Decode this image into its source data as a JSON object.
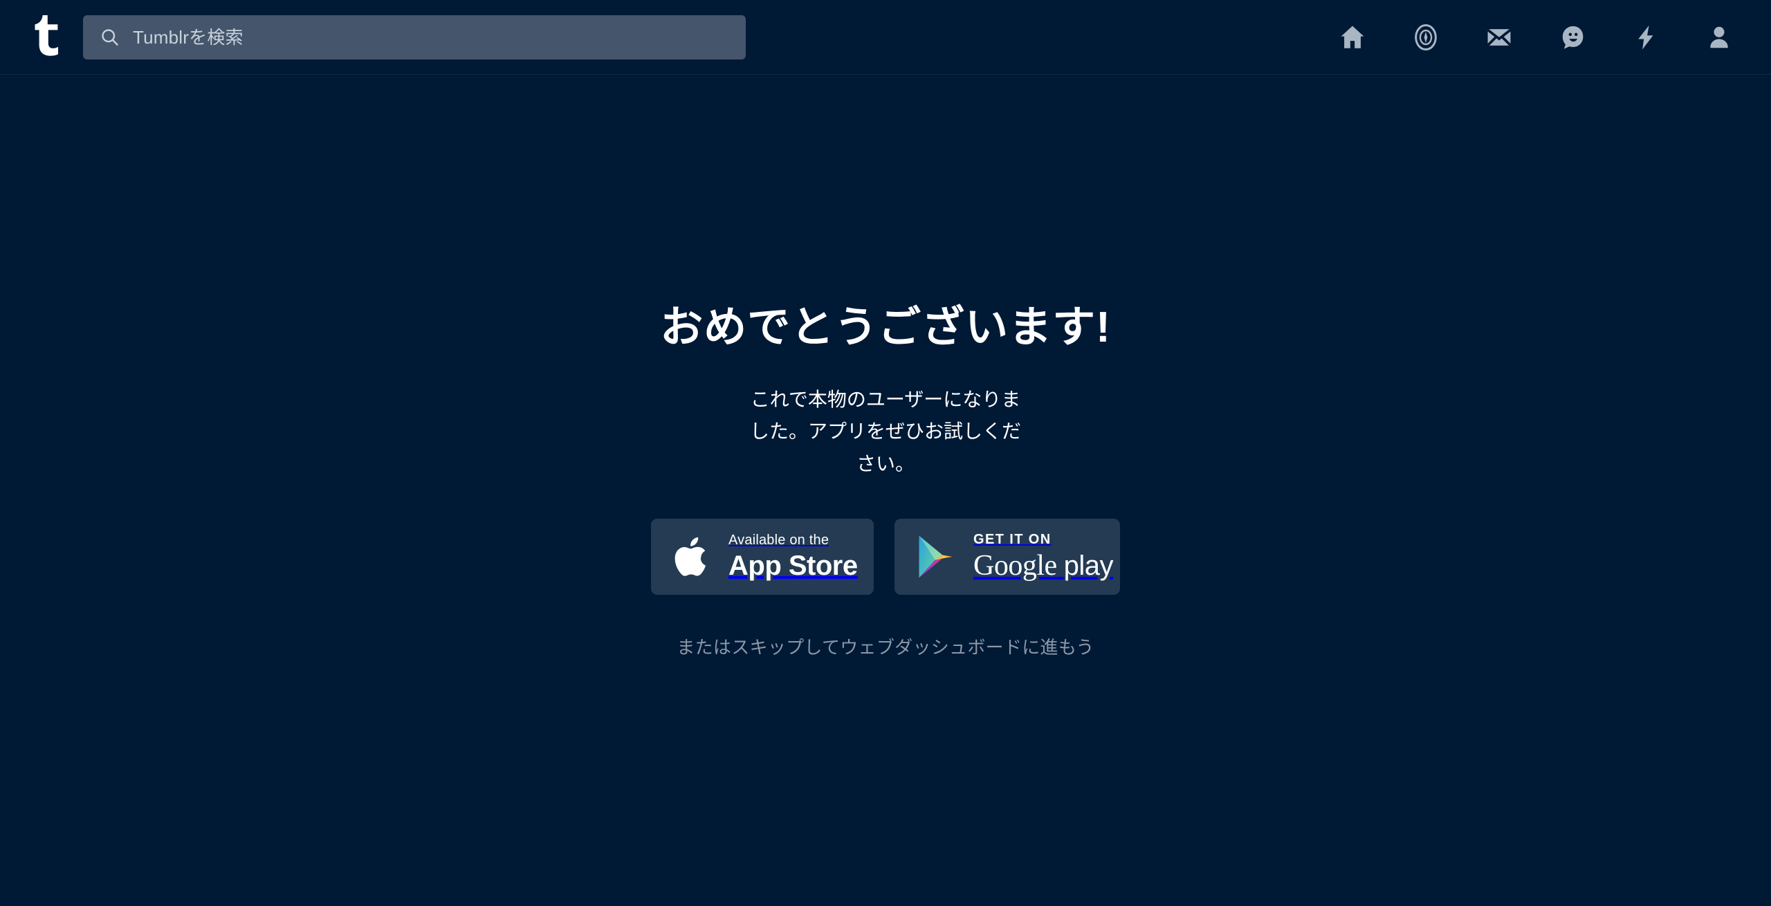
{
  "theme": {
    "background": "#001935",
    "header_background": "#001935",
    "header_border": "#0d2a47",
    "search_background": "#45556b",
    "badge_background": "#243b53",
    "text_primary": "#ffffff",
    "text_muted": "#8a98a8",
    "icon_color": "#a8b6c4"
  },
  "header": {
    "logo_label": "t",
    "search": {
      "placeholder": "Tumblrを検索",
      "value": ""
    },
    "nav": [
      {
        "name": "home-icon",
        "label": "ホーム"
      },
      {
        "name": "compass-icon",
        "label": "見つける"
      },
      {
        "name": "mail-icon",
        "label": "メッセージ"
      },
      {
        "name": "chat-smiley-icon",
        "label": "チャット"
      },
      {
        "name": "lightning-icon",
        "label": "アクティビティ"
      },
      {
        "name": "account-icon",
        "label": "アカウント"
      }
    ]
  },
  "main": {
    "headline": "おめでとうございます!",
    "subtext": "これで本物のユーザーになりました。アプリをぜひお試しください。",
    "badges": [
      {
        "name": "app-store-badge",
        "small_text": "Available on the",
        "large_text": "App Store",
        "icon": "apple-icon"
      },
      {
        "name": "google-play-badge",
        "small_text": "GET IT ON",
        "large_text_serif": "Google",
        "large_text_light": "play",
        "icon": "google-play-icon"
      }
    ],
    "skip_link": "またはスキップしてウェブダッシュボードに進もう"
  }
}
